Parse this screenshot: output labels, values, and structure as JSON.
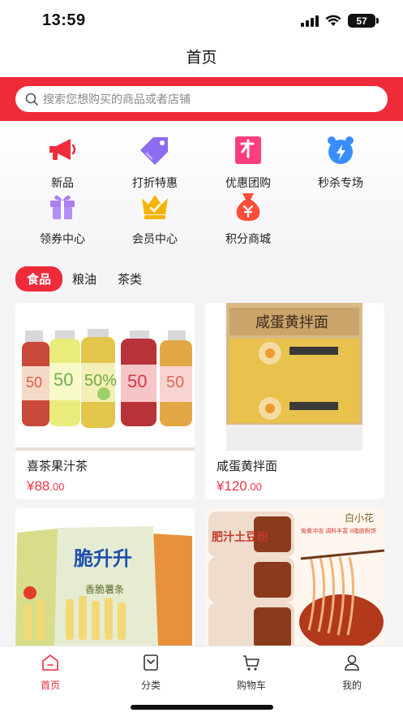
{
  "status": {
    "time": "13:59",
    "battery": "57"
  },
  "header": {
    "title": "首页"
  },
  "search": {
    "placeholder": "搜索您想购买的商品或者店铺"
  },
  "categories": [
    {
      "label": "新品",
      "icon": "megaphone-icon"
    },
    {
      "label": "打折特惠",
      "icon": "price-tag-icon"
    },
    {
      "label": "优惠团购",
      "icon": "group-buy-icon"
    },
    {
      "label": "秒杀专场",
      "icon": "alarm-clock-icon"
    },
    {
      "label": "领券中心",
      "icon": "gift-box-icon"
    },
    {
      "label": "会员中心",
      "icon": "crown-icon"
    },
    {
      "label": "积分商城",
      "icon": "money-bag-icon"
    }
  ],
  "tabs": [
    {
      "label": "食品",
      "active": true
    },
    {
      "label": "粮油"
    },
    {
      "label": "茶类"
    }
  ],
  "products": [
    {
      "name": "喜茶果汁茶",
      "currency": "¥",
      "price_int": "88",
      "price_dec": ".00"
    },
    {
      "name": "咸蛋黄拌面",
      "currency": "¥",
      "price_int": "120",
      "price_dec": ".00"
    },
    {
      "image_text": "脆升升",
      "image_subtext": "香脆薯条"
    },
    {
      "image_text": "肥汁土豆粉",
      "image_subtext": "免煮冲泡 调料丰富 0脂肪粉饼",
      "brand": "白小花"
    }
  ],
  "product_images": {
    "bottle_labels": [
      "50",
      "50",
      "50%",
      "50",
      "50"
    ],
    "noodle_box_title": "咸蛋黄拌面"
  },
  "tabbar": [
    {
      "label": "首页",
      "active": true
    },
    {
      "label": "分类"
    },
    {
      "label": "购物车"
    },
    {
      "label": "我的"
    }
  ],
  "colors": {
    "accent": "#ef2b3a",
    "price": "#e63946"
  }
}
